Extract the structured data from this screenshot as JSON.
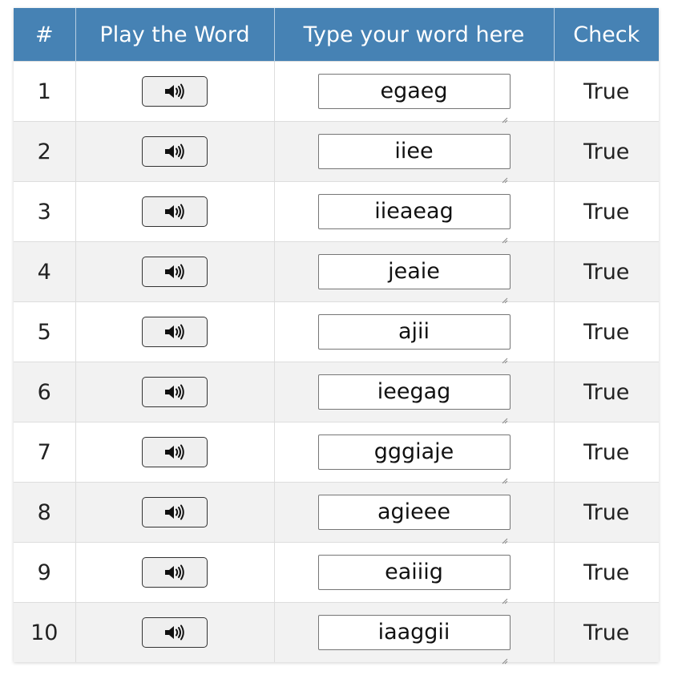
{
  "table": {
    "headers": {
      "num": "#",
      "play": "Play the Word",
      "type": "Type your word here",
      "check": "Check"
    },
    "rows": [
      {
        "num": "1",
        "word": "egaeg",
        "check": "True"
      },
      {
        "num": "2",
        "word": "iiee",
        "check": "True"
      },
      {
        "num": "3",
        "word": "iieaeag",
        "check": "True"
      },
      {
        "num": "4",
        "word": "jeaie",
        "check": "True"
      },
      {
        "num": "5",
        "word": "ajii",
        "check": "True"
      },
      {
        "num": "6",
        "word": "ieegag",
        "check": "True"
      },
      {
        "num": "7",
        "word": "gggiaje",
        "check": "True"
      },
      {
        "num": "8",
        "word": "agieee",
        "check": "True"
      },
      {
        "num": "9",
        "word": "eaiiig",
        "check": "True"
      },
      {
        "num": "10",
        "word": "iaaggii",
        "check": "True"
      }
    ]
  },
  "icons": {
    "play": "speaker-icon"
  },
  "colors": {
    "header_bg": "#4682b4",
    "stripe_bg": "#f2f2f2"
  }
}
